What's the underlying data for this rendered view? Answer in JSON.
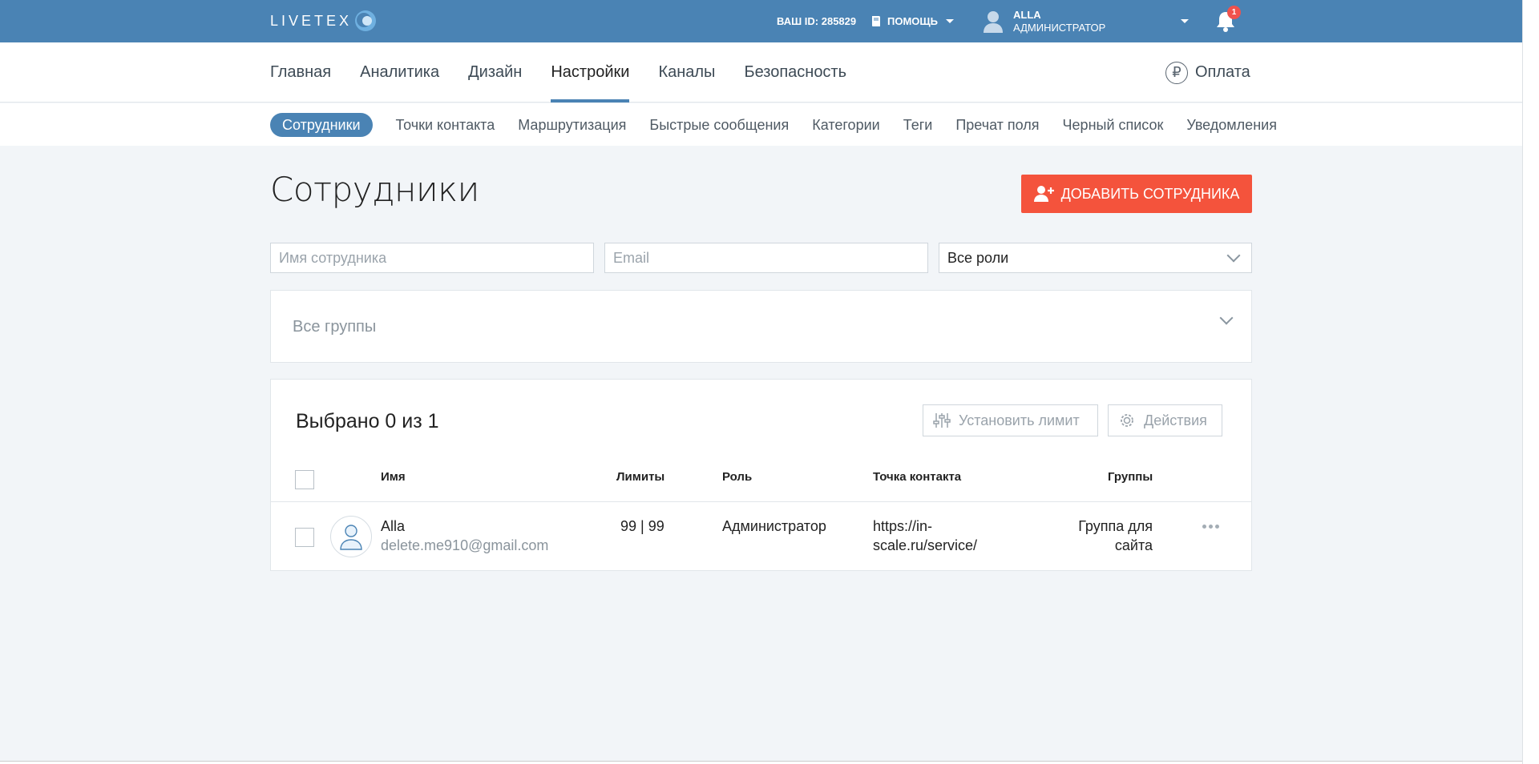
{
  "header": {
    "logo_text": "LIVETEX",
    "id_label": "ВАШ ID: 285829",
    "help_label": "ПОМОЩЬ",
    "user_name": "ALLA",
    "user_role": "АДМИНИСТРАТОР",
    "notifications_count": "1"
  },
  "main_nav": {
    "items": [
      {
        "label": "Главная"
      },
      {
        "label": "Аналитика"
      },
      {
        "label": "Дизайн"
      },
      {
        "label": "Настройки"
      },
      {
        "label": "Каналы"
      },
      {
        "label": "Безопасность"
      }
    ],
    "active": "Настройки",
    "pay_label": "Оплата",
    "pay_icon": "₽"
  },
  "sub_nav": {
    "items": [
      {
        "label": "Сотрудники"
      },
      {
        "label": "Точки контакта"
      },
      {
        "label": "Маршрутизация"
      },
      {
        "label": "Быстрые сообщения"
      },
      {
        "label": "Категории"
      },
      {
        "label": "Теги"
      },
      {
        "label": "Пречат поля"
      },
      {
        "label": "Черный список"
      },
      {
        "label": "Уведомления"
      }
    ],
    "active": "Сотрудники"
  },
  "page": {
    "title": "Сотрудники",
    "add_button": "ДОБАВИТЬ СОТРУДНИКА"
  },
  "filters": {
    "name_placeholder": "Имя сотрудника",
    "email_placeholder": "Email",
    "role_value": "Все роли",
    "groups_value": "Все группы"
  },
  "table": {
    "selected_label": "Выбрано 0 из 1",
    "limit_button": "Установить лимит",
    "actions_button": "Действия",
    "columns": {
      "name": "Имя",
      "limits": "Лимиты",
      "role": "Роль",
      "contact_point": "Точка контакта",
      "groups": "Группы"
    },
    "rows": [
      {
        "name": "Alla",
        "email": "delete.me910@gmail.com",
        "limits": "99 | 99",
        "role": "Администратор",
        "contact_point_line1": "https://in-",
        "contact_point_line2": "scale.ru/service/",
        "groups_line1": "Группа для",
        "groups_line2": "сайта"
      }
    ]
  },
  "colors": {
    "header_bg": "#4a83b4",
    "accent": "#f4533c",
    "badge": "#f0524d"
  }
}
